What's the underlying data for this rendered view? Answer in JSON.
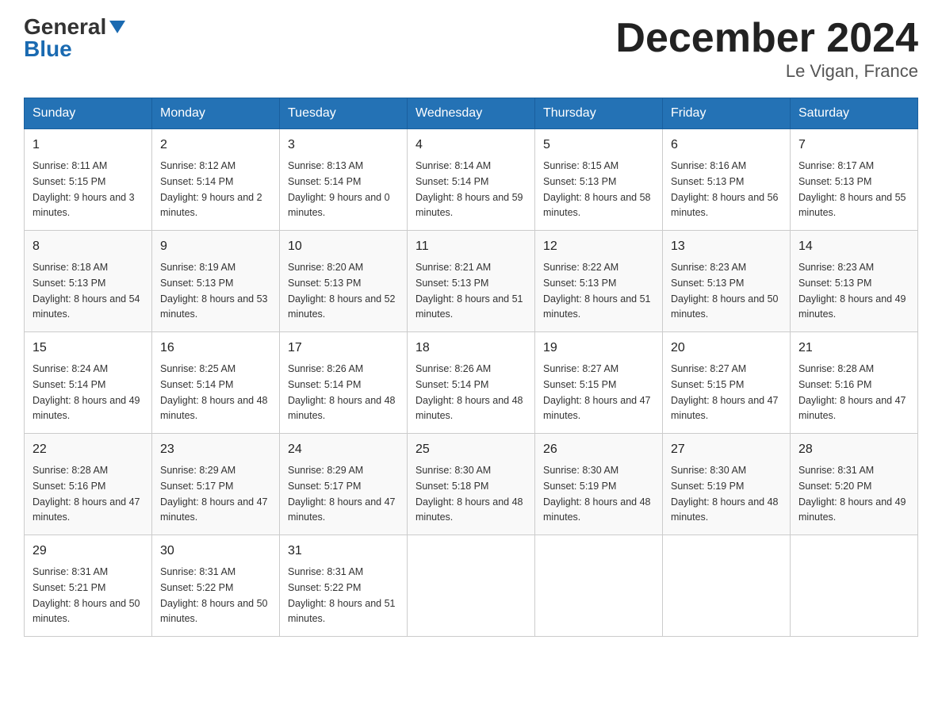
{
  "header": {
    "logo_general": "General",
    "logo_blue": "Blue",
    "title": "December 2024",
    "location": "Le Vigan, France"
  },
  "days_of_week": [
    "Sunday",
    "Monday",
    "Tuesday",
    "Wednesday",
    "Thursday",
    "Friday",
    "Saturday"
  ],
  "weeks": [
    [
      {
        "day": "1",
        "sunrise": "8:11 AM",
        "sunset": "5:15 PM",
        "daylight": "9 hours and 3 minutes."
      },
      {
        "day": "2",
        "sunrise": "8:12 AM",
        "sunset": "5:14 PM",
        "daylight": "9 hours and 2 minutes."
      },
      {
        "day": "3",
        "sunrise": "8:13 AM",
        "sunset": "5:14 PM",
        "daylight": "9 hours and 0 minutes."
      },
      {
        "day": "4",
        "sunrise": "8:14 AM",
        "sunset": "5:14 PM",
        "daylight": "8 hours and 59 minutes."
      },
      {
        "day": "5",
        "sunrise": "8:15 AM",
        "sunset": "5:13 PM",
        "daylight": "8 hours and 58 minutes."
      },
      {
        "day": "6",
        "sunrise": "8:16 AM",
        "sunset": "5:13 PM",
        "daylight": "8 hours and 56 minutes."
      },
      {
        "day": "7",
        "sunrise": "8:17 AM",
        "sunset": "5:13 PM",
        "daylight": "8 hours and 55 minutes."
      }
    ],
    [
      {
        "day": "8",
        "sunrise": "8:18 AM",
        "sunset": "5:13 PM",
        "daylight": "8 hours and 54 minutes."
      },
      {
        "day": "9",
        "sunrise": "8:19 AM",
        "sunset": "5:13 PM",
        "daylight": "8 hours and 53 minutes."
      },
      {
        "day": "10",
        "sunrise": "8:20 AM",
        "sunset": "5:13 PM",
        "daylight": "8 hours and 52 minutes."
      },
      {
        "day": "11",
        "sunrise": "8:21 AM",
        "sunset": "5:13 PM",
        "daylight": "8 hours and 51 minutes."
      },
      {
        "day": "12",
        "sunrise": "8:22 AM",
        "sunset": "5:13 PM",
        "daylight": "8 hours and 51 minutes."
      },
      {
        "day": "13",
        "sunrise": "8:23 AM",
        "sunset": "5:13 PM",
        "daylight": "8 hours and 50 minutes."
      },
      {
        "day": "14",
        "sunrise": "8:23 AM",
        "sunset": "5:13 PM",
        "daylight": "8 hours and 49 minutes."
      }
    ],
    [
      {
        "day": "15",
        "sunrise": "8:24 AM",
        "sunset": "5:14 PM",
        "daylight": "8 hours and 49 minutes."
      },
      {
        "day": "16",
        "sunrise": "8:25 AM",
        "sunset": "5:14 PM",
        "daylight": "8 hours and 48 minutes."
      },
      {
        "day": "17",
        "sunrise": "8:26 AM",
        "sunset": "5:14 PM",
        "daylight": "8 hours and 48 minutes."
      },
      {
        "day": "18",
        "sunrise": "8:26 AM",
        "sunset": "5:14 PM",
        "daylight": "8 hours and 48 minutes."
      },
      {
        "day": "19",
        "sunrise": "8:27 AM",
        "sunset": "5:15 PM",
        "daylight": "8 hours and 47 minutes."
      },
      {
        "day": "20",
        "sunrise": "8:27 AM",
        "sunset": "5:15 PM",
        "daylight": "8 hours and 47 minutes."
      },
      {
        "day": "21",
        "sunrise": "8:28 AM",
        "sunset": "5:16 PM",
        "daylight": "8 hours and 47 minutes."
      }
    ],
    [
      {
        "day": "22",
        "sunrise": "8:28 AM",
        "sunset": "5:16 PM",
        "daylight": "8 hours and 47 minutes."
      },
      {
        "day": "23",
        "sunrise": "8:29 AM",
        "sunset": "5:17 PM",
        "daylight": "8 hours and 47 minutes."
      },
      {
        "day": "24",
        "sunrise": "8:29 AM",
        "sunset": "5:17 PM",
        "daylight": "8 hours and 47 minutes."
      },
      {
        "day": "25",
        "sunrise": "8:30 AM",
        "sunset": "5:18 PM",
        "daylight": "8 hours and 48 minutes."
      },
      {
        "day": "26",
        "sunrise": "8:30 AM",
        "sunset": "5:19 PM",
        "daylight": "8 hours and 48 minutes."
      },
      {
        "day": "27",
        "sunrise": "8:30 AM",
        "sunset": "5:19 PM",
        "daylight": "8 hours and 48 minutes."
      },
      {
        "day": "28",
        "sunrise": "8:31 AM",
        "sunset": "5:20 PM",
        "daylight": "8 hours and 49 minutes."
      }
    ],
    [
      {
        "day": "29",
        "sunrise": "8:31 AM",
        "sunset": "5:21 PM",
        "daylight": "8 hours and 50 minutes."
      },
      {
        "day": "30",
        "sunrise": "8:31 AM",
        "sunset": "5:22 PM",
        "daylight": "8 hours and 50 minutes."
      },
      {
        "day": "31",
        "sunrise": "8:31 AM",
        "sunset": "5:22 PM",
        "daylight": "8 hours and 51 minutes."
      },
      null,
      null,
      null,
      null
    ]
  ]
}
